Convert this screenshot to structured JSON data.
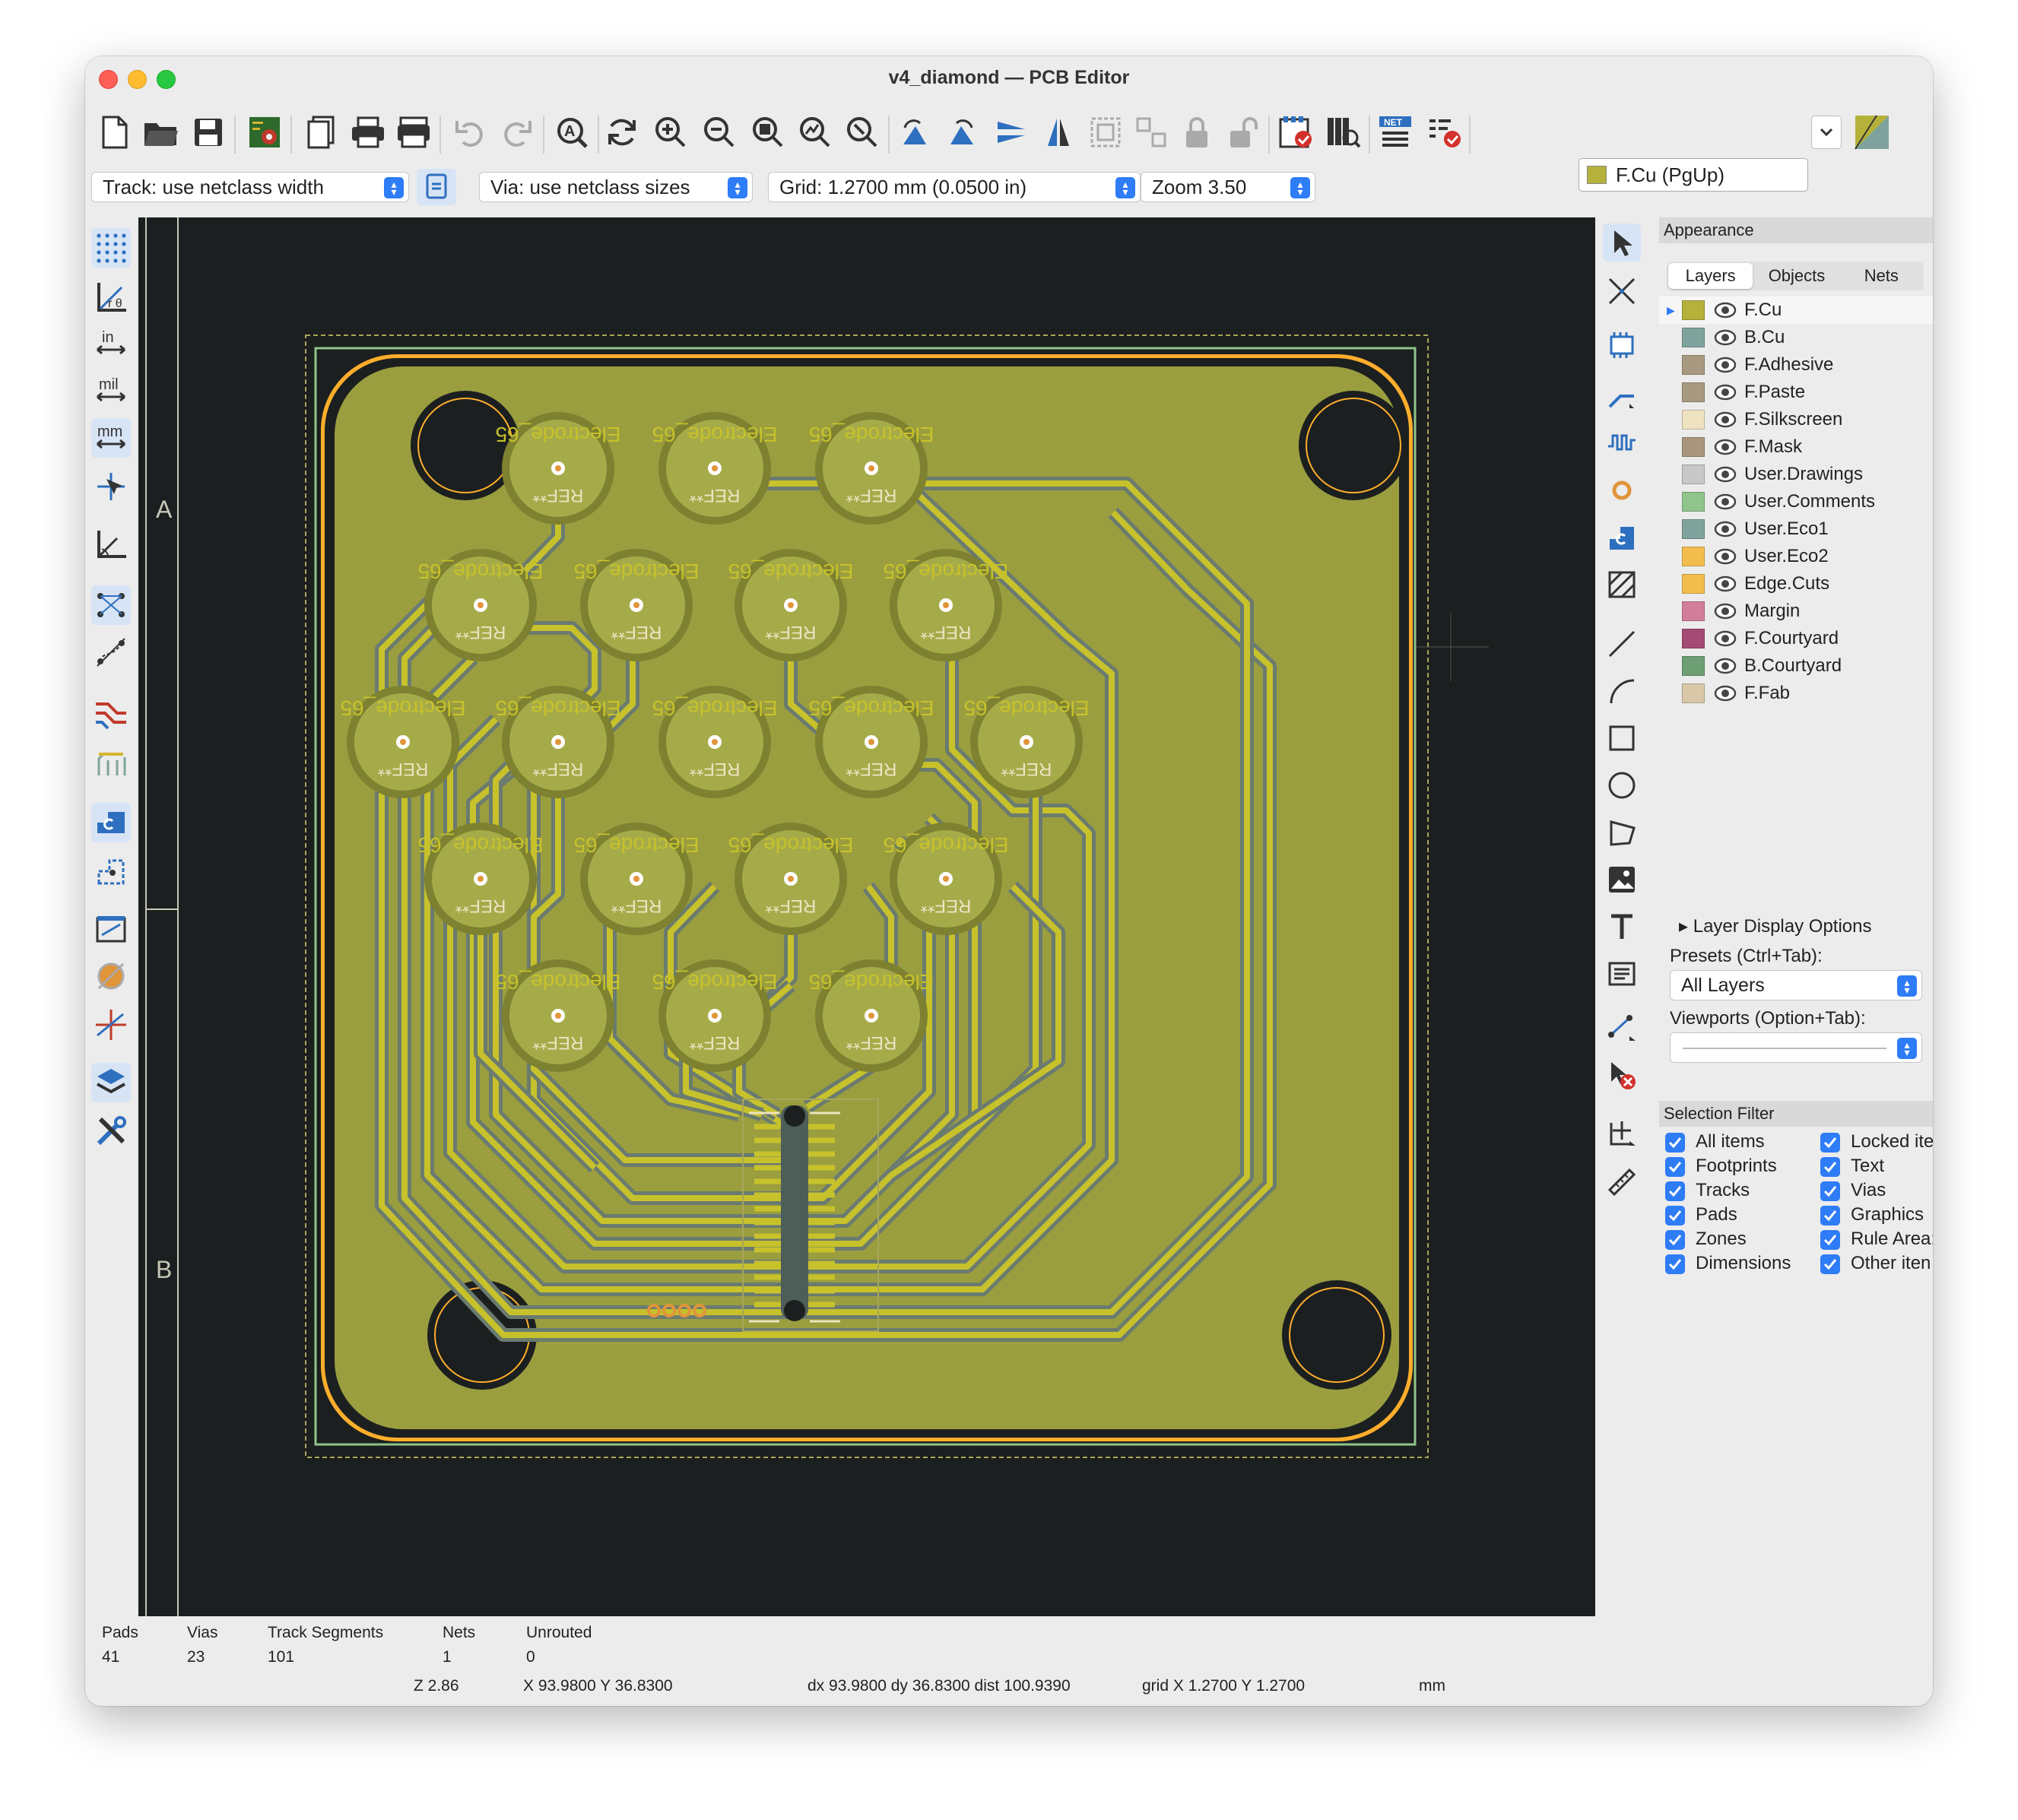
{
  "window": {
    "title": "v4_diamond — PCB Editor"
  },
  "toolbar": {
    "active_layer": "F.Cu (PgUp)",
    "track": "Track: use netclass width",
    "via": "Via: use netclass sizes",
    "grid": "Grid: 1.2700 mm (0.0500 in)",
    "zoom": "Zoom 3.50"
  },
  "lefttoolbar": {
    "in_label": "in",
    "mil_label": "mil",
    "mm_label": "mm"
  },
  "canvas": {
    "sheet_marks": [
      "A",
      "B"
    ],
    "silk_label": "Electrode_65",
    "ref_label": "REF**"
  },
  "appearance": {
    "title": "Appearance",
    "tabs": [
      "Layers",
      "Objects",
      "Nets"
    ],
    "layers": [
      {
        "name": "F.Cu",
        "color": "#b5b13a"
      },
      {
        "name": "B.Cu",
        "color": "#7fa39c"
      },
      {
        "name": "F.Adhesive",
        "color": "#a89a80"
      },
      {
        "name": "F.Paste",
        "color": "#a89a80"
      },
      {
        "name": "F.Silkscreen",
        "color": "#efe2c0"
      },
      {
        "name": "F.Mask",
        "color": "#a8967f"
      },
      {
        "name": "User.Drawings",
        "color": "#c8c8c8"
      },
      {
        "name": "User.Comments",
        "color": "#8fc48a"
      },
      {
        "name": "User.Eco1",
        "color": "#7fa39c"
      },
      {
        "name": "User.Eco2",
        "color": "#f3bd4e"
      },
      {
        "name": "Edge.Cuts",
        "color": "#f3bd4e"
      },
      {
        "name": "Margin",
        "color": "#d27e9a"
      },
      {
        "name": "F.Courtyard",
        "color": "#a44a75"
      },
      {
        "name": "B.Courtyard",
        "color": "#6e9e74"
      },
      {
        "name": "F.Fab",
        "color": "#d8c8a8"
      }
    ],
    "layer_display_options": "Layer Display Options",
    "presets_label": "Presets (Ctrl+Tab):",
    "presets_value": "All Layers",
    "viewports_label": "Viewports (Option+Tab):",
    "viewports_value": ""
  },
  "selection_filter": {
    "title": "Selection Filter",
    "left": [
      "All items",
      "Footprints",
      "Tracks",
      "Pads",
      "Zones",
      "Dimensions"
    ],
    "right": [
      "Locked ite",
      "Text",
      "Vias",
      "Graphics",
      "Rule Area:",
      "Other iten"
    ]
  },
  "stats": {
    "pads_label": "Pads",
    "pads": "41",
    "vias_label": "Vias",
    "vias": "23",
    "tracks_label": "Track Segments",
    "tracks": "101",
    "nets_label": "Nets",
    "nets": "1",
    "unrouted_label": "Unrouted",
    "unrouted": "0"
  },
  "statusbar": {
    "z": "Z 2.86",
    "xy": "X 93.9800  Y 36.8300",
    "delta": "dx 93.9800  dy 36.8300  dist 100.9390",
    "grid": "grid X 1.2700  Y 1.2700",
    "units": "mm"
  },
  "colors": {
    "board": "#9a9e3f",
    "track": "#c7c22b",
    "canvas_bg": "#1c1f1f",
    "accent": "#2e7cf6"
  }
}
